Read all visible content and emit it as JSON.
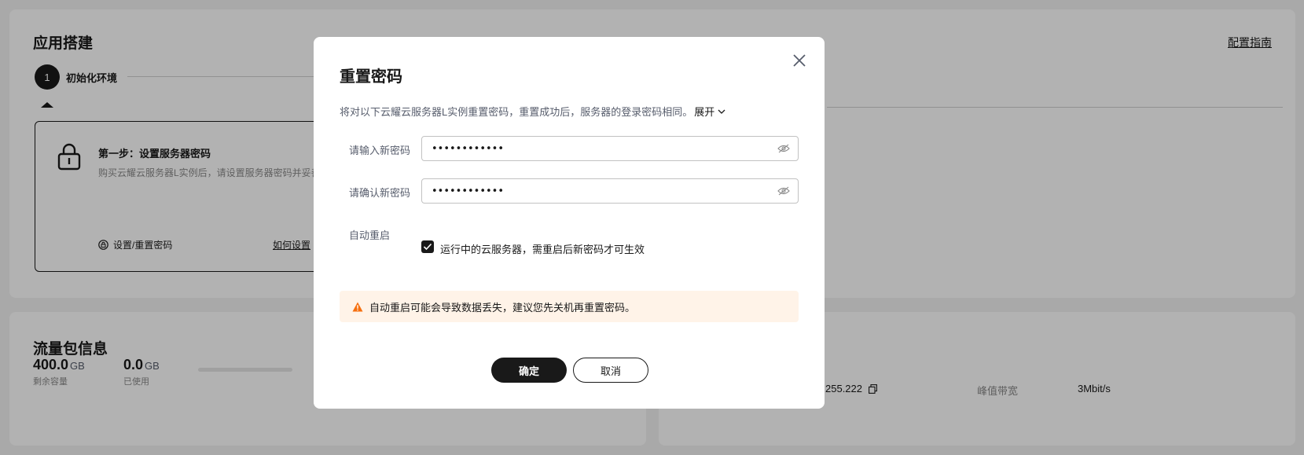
{
  "build": {
    "title": "应用搭建",
    "guide_link": "配置指南",
    "step_number": "1",
    "step_name": "初始化环境",
    "step_box": {
      "title": "第一步：设置服务器密码",
      "desc": "购买云耀云服务器L实例后，请设置服务器密码并妥善",
      "set_link": "设置/重置密码",
      "howto_link": "如何设置"
    }
  },
  "traffic": {
    "title": "流量包信息",
    "remaining_value": "400.0",
    "remaining_unit": "GB",
    "remaining_label": "剩余容量",
    "used_value": "0.0",
    "used_unit": "GB",
    "used_label": "已使用"
  },
  "server_info": {
    "ip_fragment": "255.222",
    "bandwidth_label": "峰值带宽",
    "bandwidth_value": "3Mbit/s"
  },
  "dialog": {
    "title": "重置密码",
    "desc": "将对以下云耀云服务器L实例重置密码，重置成功后，服务器的登录密码相同。",
    "expand": "展开",
    "new_pwd_label": "请输入新密码",
    "new_pwd_value": "••••••••••••",
    "confirm_pwd_label": "请确认新密码",
    "confirm_pwd_value": "••••••••••••",
    "auto_restart_label": "自动重启",
    "auto_restart_text": "运行中的云服务器，需重启后新密码才可生效",
    "auto_restart_checked": true,
    "warning": "自动重启可能会导致数据丢失，建议您先关机再重置密码。",
    "ok": "确定",
    "cancel": "取消"
  },
  "colors": {
    "primary": "#191919",
    "warning_bg": "#fff3e8",
    "warning_icon": "#f66f0f"
  }
}
